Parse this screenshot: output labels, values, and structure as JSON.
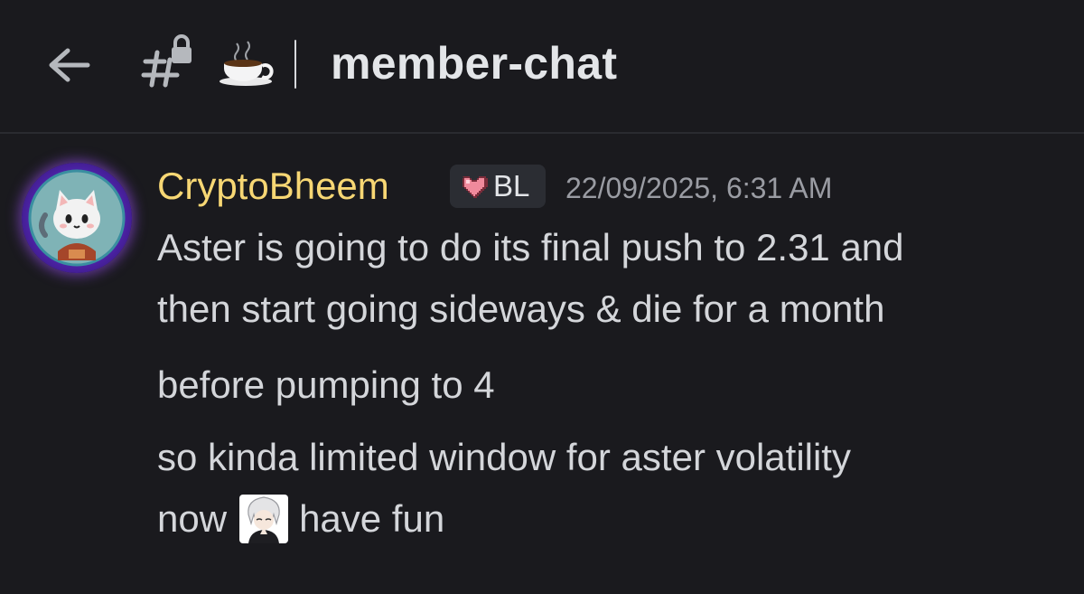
{
  "header": {
    "back_icon": "arrow-left-icon",
    "channel_icon": "locked-hashtag-icon",
    "channel_emoji": "☕",
    "channel_name": "member-chat"
  },
  "message": {
    "author": "CryptoBheem",
    "author_color": "#f7d774",
    "tag": {
      "icon": "pixel-heart-icon",
      "label": "BL"
    },
    "timestamp": "22/09/2025, 6:31 AM",
    "lines": [
      "Aster is going to do its final push to 2.31 and",
      "then start going sideways & die for a month",
      "before pumping to 4",
      "so kinda limited window for aster volatility"
    ],
    "last_line": {
      "before_emoji": "now",
      "emoji": "praying-anime-character-emoji",
      "after_emoji": "have fun"
    }
  },
  "colors": {
    "background": "#1a1a1e",
    "text": "#d4d6da",
    "muted": "#9a9ca3",
    "badge_bg": "#2b2d33"
  }
}
